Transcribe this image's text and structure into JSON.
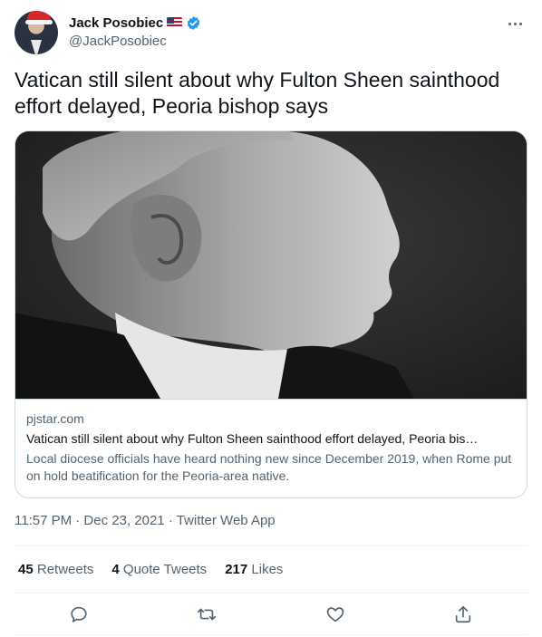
{
  "author": {
    "display_name": "Jack Posobiec",
    "handle": "@JackPosobiec",
    "flag_emoji": "us-flag-icon",
    "verified_color": "#1d9bf0"
  },
  "tweet": {
    "text": "Vatican still silent about why Fulton Sheen sainthood effort delayed, Peoria bishop says"
  },
  "link_card": {
    "domain": "pjstar.com",
    "title": "Vatican still silent about why Fulton Sheen sainthood effort delayed, Peoria bis…",
    "description": "Local diocese officials have heard nothing new since December 2019, when Rome put on hold beatification for the Peoria-area native."
  },
  "meta": {
    "text": "11:57 PM · Dec 23, 2021 · Twitter Web App"
  },
  "stats": {
    "retweets_count": "45",
    "retweets_label": "Retweets",
    "quotes_count": "4",
    "quotes_label": "Quote Tweets",
    "likes_count": "217",
    "likes_label": "Likes"
  },
  "colors": {
    "text_primary": "#0f1419",
    "text_secondary": "#536471",
    "border": "#cfd9de",
    "accent": "#1d9bf0"
  }
}
